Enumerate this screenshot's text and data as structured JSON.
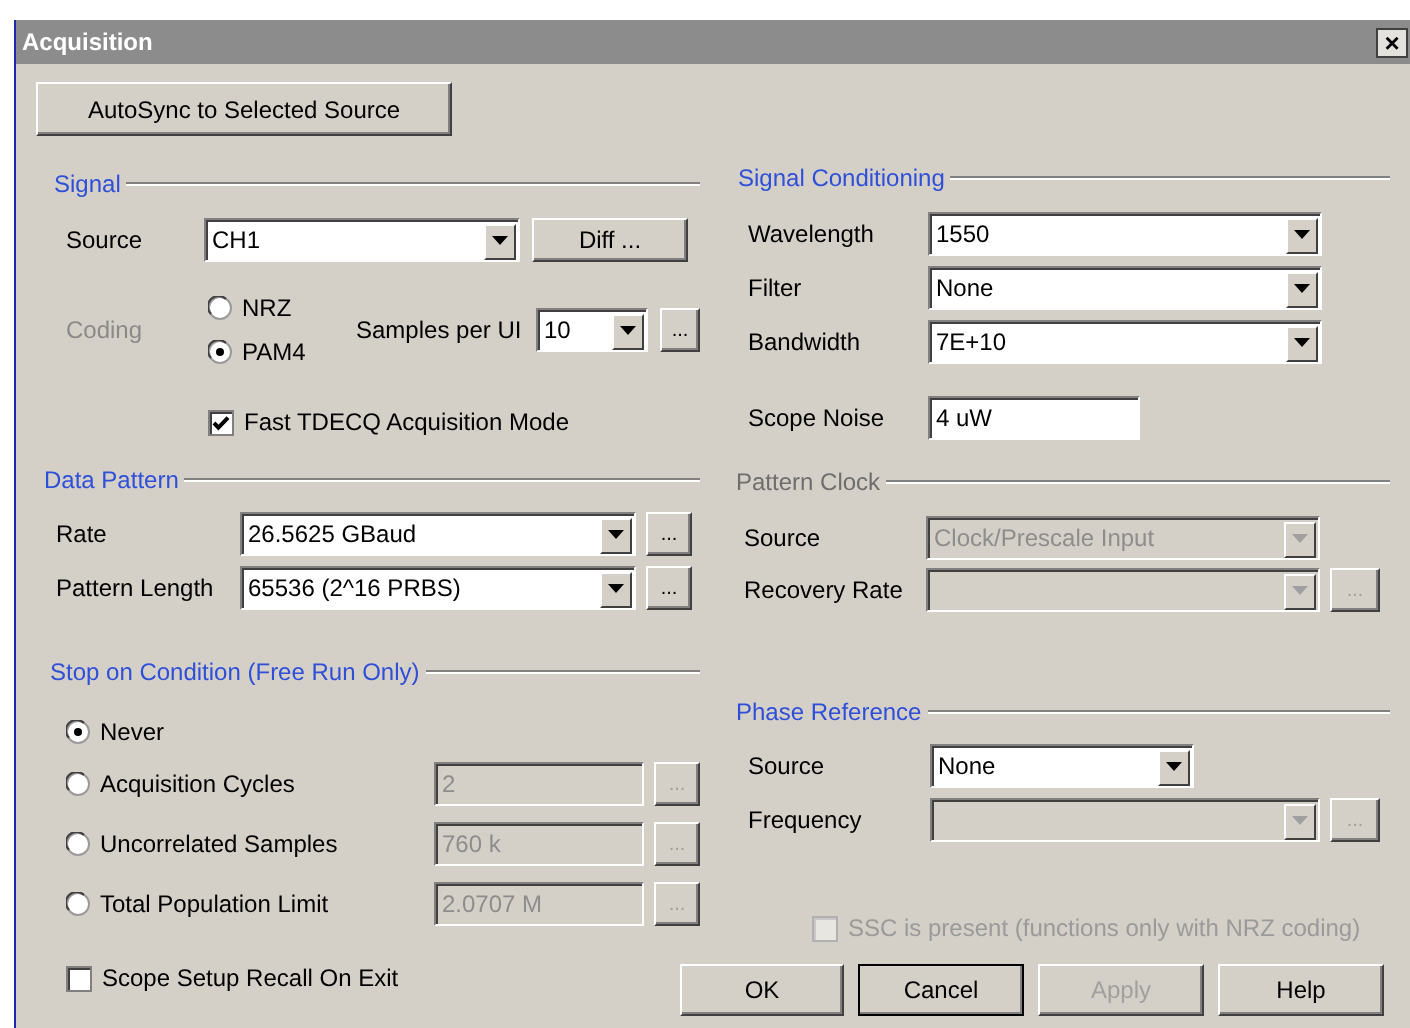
{
  "window": {
    "title": "Acquisition",
    "close_button": "×"
  },
  "autosync_button": "AutoSync to Selected Source",
  "sections": [
    {
      "title": "Signal",
      "disabled": false,
      "rows": [
        {
          "kind": "combo",
          "label": "Source",
          "value": "CH1",
          "disabled": false,
          "button": "Diff ..."
        },
        {
          "kind": "coding",
          "label": "Coding",
          "disabled": true,
          "options": [
            {
              "label": "NRZ",
              "selected": false
            },
            {
              "label": "PAM4",
              "selected": true
            }
          ],
          "samples": {
            "label": "Samples per UI",
            "value": "10",
            "disabled": false,
            "more": {
              "label": "...",
              "disabled": false
            }
          }
        },
        {
          "kind": "checkbox",
          "label": "Fast TDECQ Acquisition Mode",
          "checked": true
        }
      ]
    },
    {
      "title": "Data Pattern",
      "disabled": false,
      "rows": [
        {
          "kind": "combo",
          "label": "Rate",
          "value": "26.5625 GBaud",
          "disabled": false,
          "more": {
            "label": "...",
            "disabled": false
          }
        },
        {
          "kind": "combo",
          "label": "Pattern Length",
          "value": "65536 (2^16 PRBS)",
          "disabled": false,
          "more": {
            "label": "...",
            "disabled": false
          }
        }
      ]
    },
    {
      "title": "Stop on Condition (Free Run Only)",
      "disabled": false,
      "rows": [
        {
          "kind": "radio",
          "label": "Never",
          "selected": true
        },
        {
          "kind": "radio",
          "label": "Acquisition Cycles",
          "selected": false,
          "field": {
            "value": "2",
            "disabled": true
          },
          "more": {
            "label": "...",
            "disabled": true
          }
        },
        {
          "kind": "radio",
          "label": "Uncorrelated Samples",
          "selected": false,
          "field": {
            "value": "760 k",
            "disabled": true
          },
          "more": {
            "label": "...",
            "disabled": true
          }
        },
        {
          "kind": "radio",
          "label": "Total Population Limit",
          "selected": false,
          "field": {
            "value": "2.0707 M",
            "disabled": true
          },
          "more": {
            "label": "...",
            "disabled": true
          }
        }
      ]
    },
    {
      "title": "Signal Conditioning",
      "disabled": false,
      "rows": [
        {
          "kind": "combo",
          "label": "Wavelength",
          "value": "1550",
          "disabled": false
        },
        {
          "kind": "combo",
          "label": "Filter",
          "value": "None",
          "disabled": false
        },
        {
          "kind": "combo",
          "label": "Bandwidth",
          "value": "7E+10",
          "disabled": false
        },
        {
          "kind": "input",
          "label": "Scope Noise",
          "value": "4 uW",
          "disabled": false
        }
      ]
    },
    {
      "title": "Pattern Clock",
      "disabled": true,
      "rows": [
        {
          "kind": "combo",
          "label": "Source",
          "value": "Clock/Prescale Input",
          "disabled": true
        },
        {
          "kind": "combo",
          "label": "Recovery Rate",
          "disabled": true,
          "more": {
            "label": "...",
            "disabled": true
          }
        }
      ]
    },
    {
      "title": "Phase Reference",
      "disabled": false,
      "rows": [
        {
          "kind": "combo",
          "label": "Source",
          "value": "None",
          "disabled": false
        },
        {
          "kind": "combo",
          "label": "Frequency",
          "disabled": true,
          "more": {
            "label": "...",
            "disabled": true
          }
        }
      ]
    }
  ],
  "recall_checkbox": {
    "label": "Scope Setup Recall On Exit",
    "checked": false
  },
  "ssc_checkbox": {
    "label": "SSC is present (functions only with NRZ coding)",
    "checked": false,
    "disabled": true
  },
  "buttons": [
    {
      "label": "OK",
      "disabled": false,
      "focused": false
    },
    {
      "label": "Cancel",
      "disabled": false,
      "focused": true
    },
    {
      "label": "Apply",
      "disabled": true,
      "focused": false
    },
    {
      "label": "Help",
      "disabled": false,
      "focused": false
    }
  ]
}
